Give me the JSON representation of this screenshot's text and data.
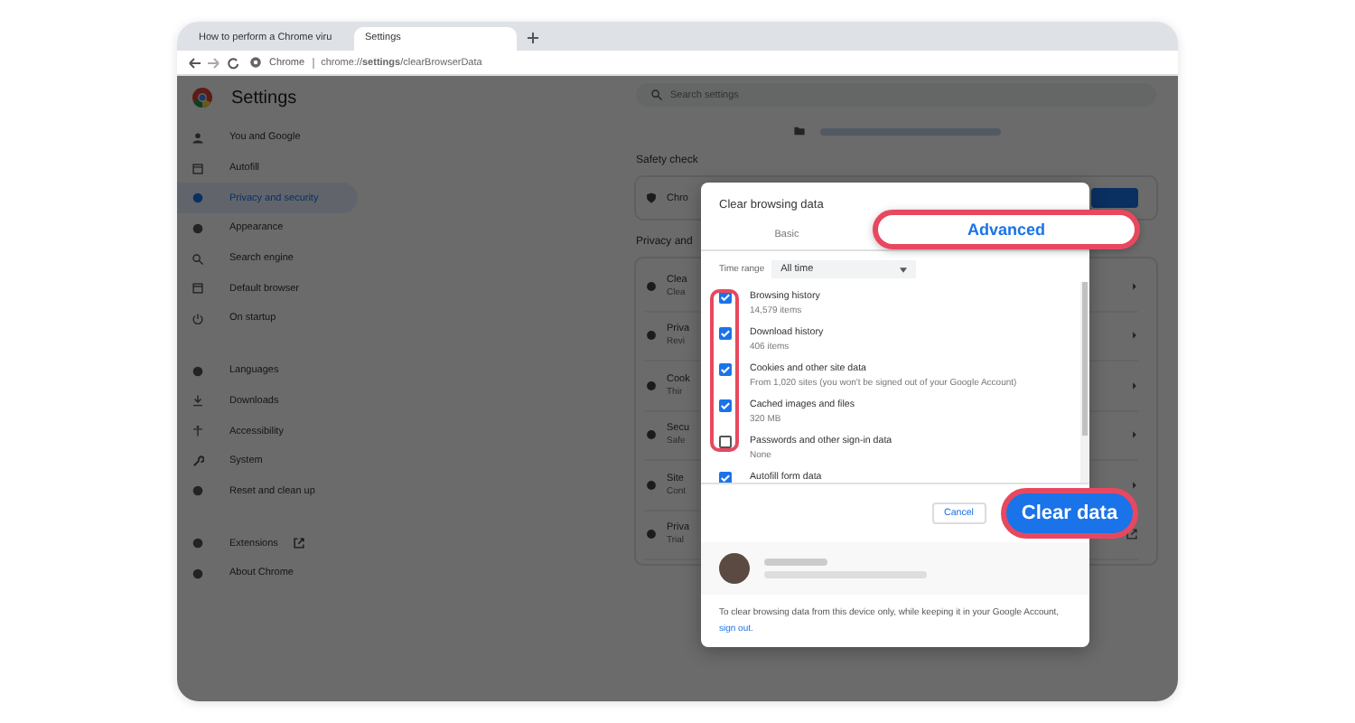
{
  "browser": {
    "tabs": [
      {
        "title": "How to perform a Chrome viru",
        "selected": false
      },
      {
        "title": "Settings",
        "selected": true
      }
    ],
    "address": "Chrome",
    "url": "chrome://**settings**/clearBrowserData"
  },
  "sidebar": {
    "title": "Settings",
    "sections": [
      {
        "items": [
          {
            "label": "You and Google",
            "selected": false
          },
          {
            "label": "Autofill",
            "selected": false
          },
          {
            "label": "Privacy and security",
            "selected": true
          },
          {
            "label": "Appearance",
            "selected": false
          },
          {
            "label": "Search engine",
            "selected": false
          },
          {
            "label": "Default browser",
            "selected": false
          },
          {
            "label": "On startup",
            "selected": false
          }
        ]
      },
      {
        "items": [
          {
            "label": "Languages",
            "selected": false
          },
          {
            "label": "Downloads",
            "selected": false
          },
          {
            "label": "Accessibility",
            "selected": false
          },
          {
            "label": "System",
            "selected": false
          },
          {
            "label": "Reset and clean up",
            "selected": false
          }
        ]
      },
      {
        "items": [
          {
            "label": "Extensions",
            "selected": false,
            "external": true
          },
          {
            "label": "About Chrome",
            "selected": false
          }
        ]
      }
    ]
  },
  "main": {
    "search": {
      "placeholder": "Search settings"
    },
    "safety_heading": "Safety check",
    "safety_card": {
      "title": "Chro"
    },
    "privacy_heading": "Privacy and",
    "privacy_rows": [
      {
        "title": "Clea",
        "subtitle": "Clea",
        "kind": "nav"
      },
      {
        "title": "Priva",
        "subtitle": "Revi",
        "kind": "nav"
      },
      {
        "title": "Cook",
        "subtitle": "Thir",
        "kind": "nav"
      },
      {
        "title": "Secu",
        "subtitle": "Safe",
        "kind": "nav"
      },
      {
        "title": "Site",
        "subtitle": "Cont",
        "kind": "nav"
      },
      {
        "title": "Priva",
        "subtitle": "Trial",
        "kind": "link"
      }
    ]
  },
  "dialog": {
    "title": "Clear browsing data",
    "tabs": [
      {
        "label": "Basic",
        "selected": false
      },
      {
        "label": "Advanced",
        "selected": true
      }
    ],
    "time_range": {
      "label": "Time range",
      "value": "All time"
    },
    "items": [
      {
        "label": "Browsing history",
        "detail": "14,579 items",
        "checked": true
      },
      {
        "label": "Download history",
        "detail": "406 items",
        "checked": true
      },
      {
        "label": "Cookies and other site data",
        "detail": "From 1,020 sites (you won't be signed out of your Google Account)",
        "checked": true
      },
      {
        "label": "Cached images and files",
        "detail": "320 MB",
        "checked": true
      },
      {
        "label": "Passwords and other sign-in data",
        "detail": "None",
        "checked": false
      },
      {
        "label": "Autofill form data",
        "checked": true
      }
    ],
    "buttons": {
      "cancel": "Cancel",
      "confirm": "Clear data"
    },
    "footer": "To clear browsing data from this device only, while keeping it in your Google Account,",
    "footer_link": "sign out."
  }
}
